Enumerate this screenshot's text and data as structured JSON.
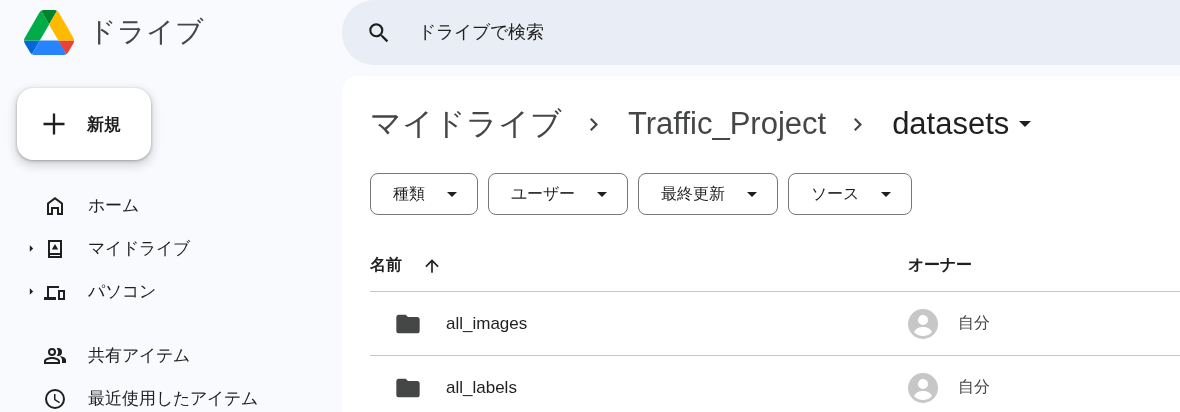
{
  "app": {
    "title": "ドライブ"
  },
  "search": {
    "placeholder": "ドライブで検索"
  },
  "new_button": {
    "label": "新規"
  },
  "sidebar": {
    "sections": [
      [
        {
          "label": "ホーム",
          "kind": "home",
          "expandable": false
        },
        {
          "label": "マイドライブ",
          "kind": "drive",
          "expandable": true
        },
        {
          "label": "パソコン",
          "kind": "computer",
          "expandable": true
        }
      ],
      [
        {
          "label": "共有アイテム",
          "kind": "shared",
          "expandable": false
        },
        {
          "label": "最近使用したアイテム",
          "kind": "recent",
          "expandable": false
        }
      ]
    ]
  },
  "breadcrumb": [
    {
      "label": "マイドライブ",
      "current": false
    },
    {
      "label": "Traffic_Project",
      "current": false
    },
    {
      "label": "datasets",
      "current": true
    }
  ],
  "filters": [
    "種類",
    "ユーザー",
    "最終更新",
    "ソース"
  ],
  "table": {
    "columns": [
      {
        "label": "名前",
        "sorted": true
      },
      {
        "label": "オーナー",
        "sorted": false
      }
    ],
    "rows": [
      {
        "name": "all_images",
        "owner": "自分"
      },
      {
        "name": "all_labels",
        "owner": "自分"
      }
    ]
  }
}
